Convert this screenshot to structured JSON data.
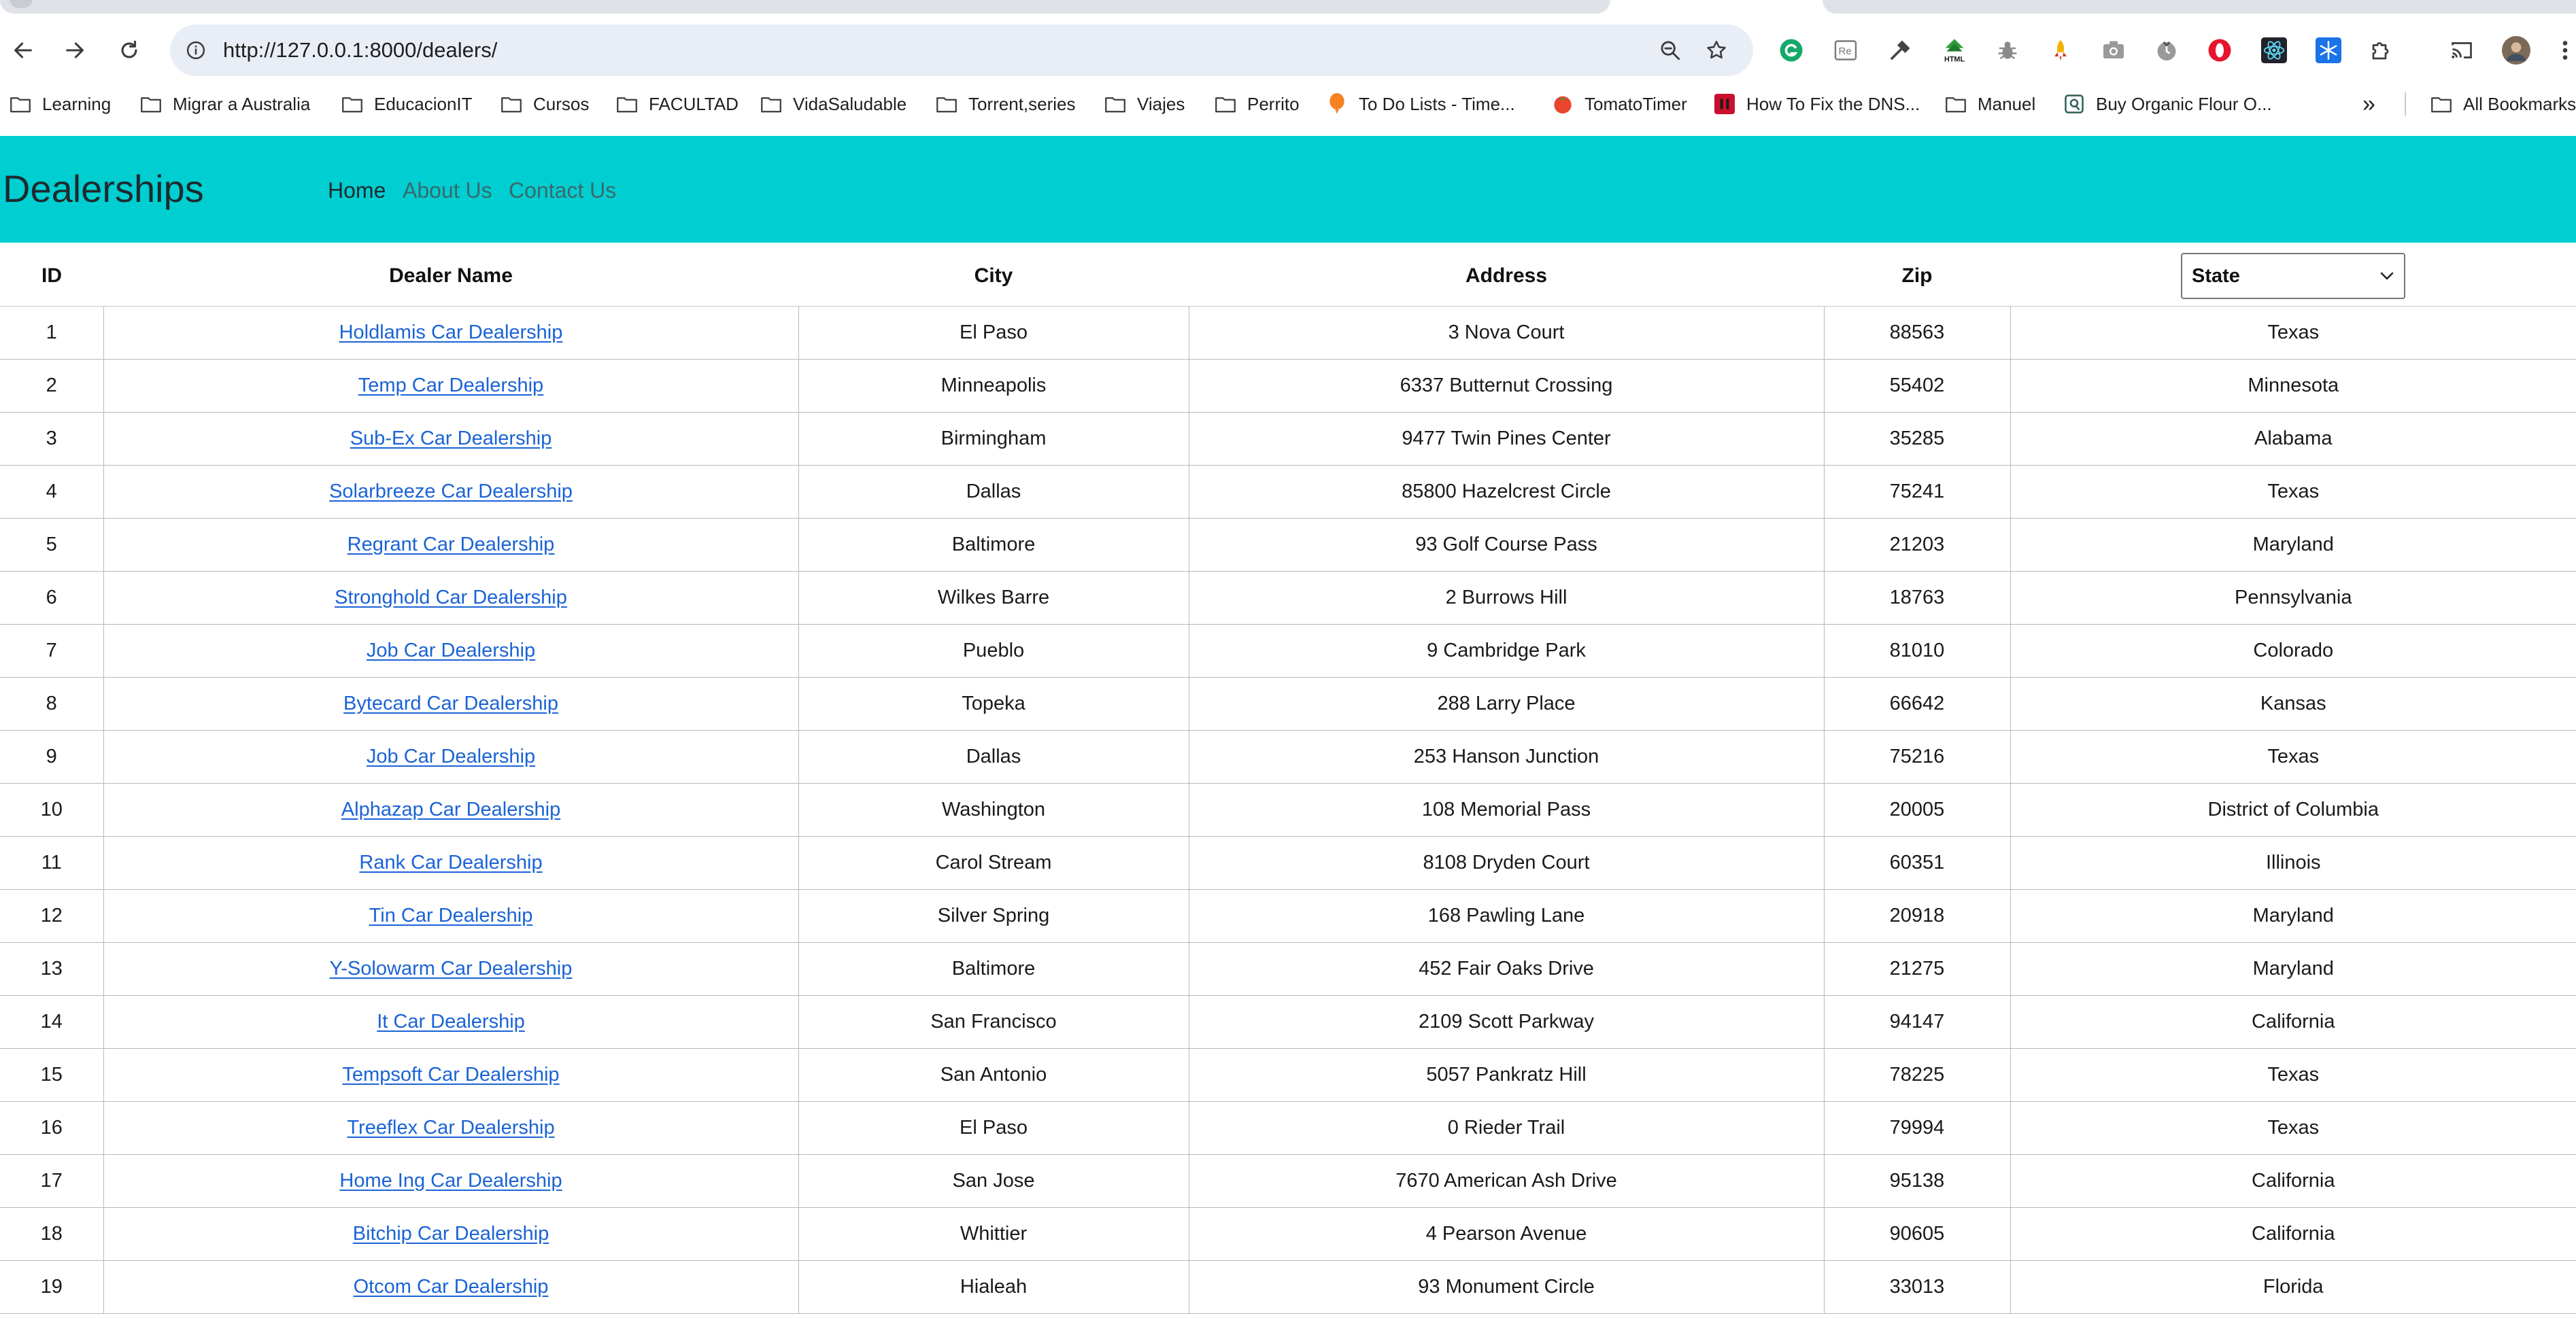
{
  "browser": {
    "url": "http://127.0.0.1:8000/dealers/",
    "bookmarks": [
      {
        "label": "Learning",
        "icon": "folder-icon"
      },
      {
        "label": "Migrar a Australia",
        "icon": "folder-icon"
      },
      {
        "label": "EducacionIT",
        "icon": "folder-icon"
      },
      {
        "label": "Cursos",
        "icon": "folder-icon"
      },
      {
        "label": "FACULTAD",
        "icon": "folder-icon"
      },
      {
        "label": "VidaSaludable",
        "icon": "folder-icon"
      },
      {
        "label": "Torrent,series",
        "icon": "folder-icon"
      },
      {
        "label": "Viajes",
        "icon": "folder-icon"
      },
      {
        "label": "Perrito",
        "icon": "folder-icon"
      },
      {
        "label": "To Do Lists - Time...",
        "icon": "orange-balloon-icon"
      },
      {
        "label": "TomatoTimer",
        "icon": "tomato-icon"
      },
      {
        "label": "How To Fix the DNS...",
        "icon": "red-site-icon"
      },
      {
        "label": "Manuel",
        "icon": "folder-icon"
      },
      {
        "label": "Buy Organic Flour O...",
        "icon": "store-icon"
      }
    ],
    "overflow_label": "»",
    "all_bookmarks_label": "All Bookmarks"
  },
  "header": {
    "brand": "Dealerships",
    "nav": {
      "home": "Home",
      "about": "About Us",
      "contact": "Contact Us"
    },
    "background_color": "#00ced1"
  },
  "table": {
    "columns": {
      "id": "ID",
      "name": "Dealer Name",
      "city": "City",
      "address": "Address",
      "zip": "Zip"
    },
    "state_select": {
      "selected": "State"
    },
    "link_color": "#1a63d6",
    "rows": [
      {
        "id": "1",
        "name": "Holdlamis Car Dealership",
        "city": "El Paso",
        "address": "3 Nova Court",
        "zip": "88563",
        "state": "Texas"
      },
      {
        "id": "2",
        "name": "Temp Car Dealership",
        "city": "Minneapolis",
        "address": "6337 Butternut Crossing",
        "zip": "55402",
        "state": "Minnesota"
      },
      {
        "id": "3",
        "name": "Sub-Ex Car Dealership",
        "city": "Birmingham",
        "address": "9477 Twin Pines Center",
        "zip": "35285",
        "state": "Alabama"
      },
      {
        "id": "4",
        "name": "Solarbreeze Car Dealership",
        "city": "Dallas",
        "address": "85800 Hazelcrest Circle",
        "zip": "75241",
        "state": "Texas"
      },
      {
        "id": "5",
        "name": "Regrant Car Dealership",
        "city": "Baltimore",
        "address": "93 Golf Course Pass",
        "zip": "21203",
        "state": "Maryland"
      },
      {
        "id": "6",
        "name": "Stronghold Car Dealership",
        "city": "Wilkes Barre",
        "address": "2 Burrows Hill",
        "zip": "18763",
        "state": "Pennsylvania"
      },
      {
        "id": "7",
        "name": "Job Car Dealership",
        "city": "Pueblo",
        "address": "9 Cambridge Park",
        "zip": "81010",
        "state": "Colorado"
      },
      {
        "id": "8",
        "name": "Bytecard Car Dealership",
        "city": "Topeka",
        "address": "288 Larry Place",
        "zip": "66642",
        "state": "Kansas"
      },
      {
        "id": "9",
        "name": "Job Car Dealership",
        "city": "Dallas",
        "address": "253 Hanson Junction",
        "zip": "75216",
        "state": "Texas"
      },
      {
        "id": "10",
        "name": "Alphazap Car Dealership",
        "city": "Washington",
        "address": "108 Memorial Pass",
        "zip": "20005",
        "state": "District of Columbia"
      },
      {
        "id": "11",
        "name": "Rank Car Dealership",
        "city": "Carol Stream",
        "address": "8108 Dryden Court",
        "zip": "60351",
        "state": "Illinois"
      },
      {
        "id": "12",
        "name": "Tin Car Dealership",
        "city": "Silver Spring",
        "address": "168 Pawling Lane",
        "zip": "20918",
        "state": "Maryland"
      },
      {
        "id": "13",
        "name": "Y-Solowarm Car Dealership",
        "city": "Baltimore",
        "address": "452 Fair Oaks Drive",
        "zip": "21275",
        "state": "Maryland"
      },
      {
        "id": "14",
        "name": "It Car Dealership",
        "city": "San Francisco",
        "address": "2109 Scott Parkway",
        "zip": "94147",
        "state": "California"
      },
      {
        "id": "15",
        "name": "Tempsoft Car Dealership",
        "city": "San Antonio",
        "address": "5057 Pankratz Hill",
        "zip": "78225",
        "state": "Texas"
      },
      {
        "id": "16",
        "name": "Treeflex Car Dealership",
        "city": "El Paso",
        "address": "0 Rieder Trail",
        "zip": "79994",
        "state": "Texas"
      },
      {
        "id": "17",
        "name": "Home Ing Car Dealership",
        "city": "San Jose",
        "address": "7670 American Ash Drive",
        "zip": "95138",
        "state": "California"
      },
      {
        "id": "18",
        "name": "Bitchip Car Dealership",
        "city": "Whittier",
        "address": "4 Pearson Avenue",
        "zip": "90605",
        "state": "California"
      },
      {
        "id": "19",
        "name": "Otcom Car Dealership",
        "city": "Hialeah",
        "address": "93 Monument Circle",
        "zip": "33013",
        "state": "Florida"
      }
    ]
  }
}
